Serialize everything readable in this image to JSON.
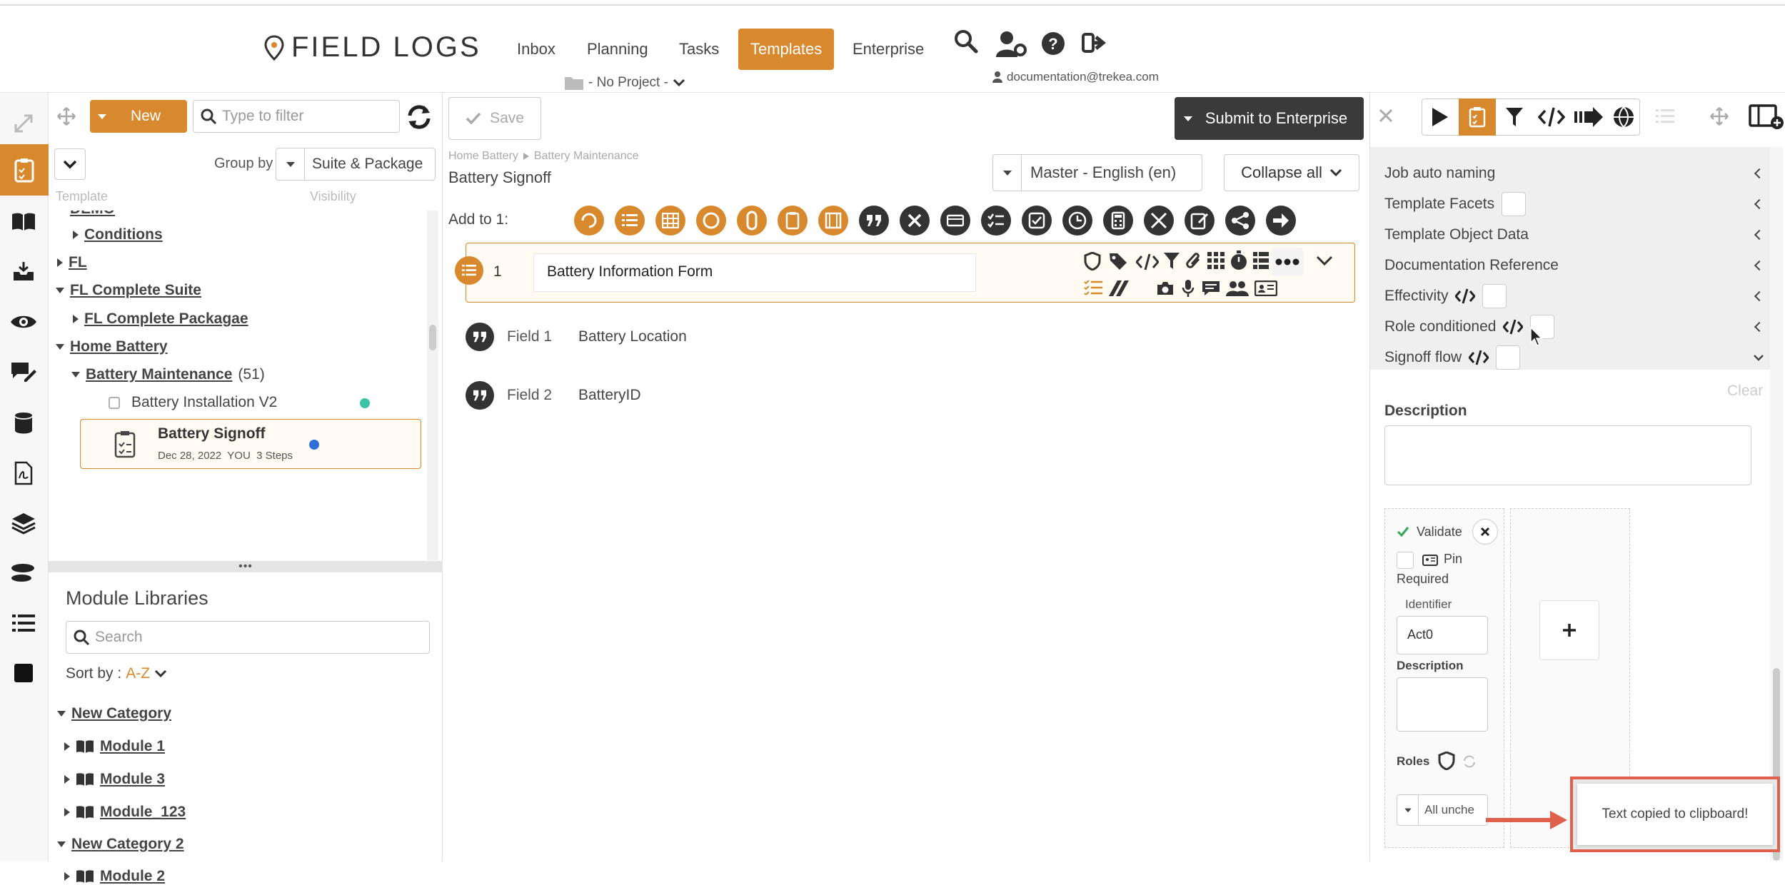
{
  "header": {
    "logo_text": "FIELD LOGS",
    "nav": [
      "Inbox",
      "Planning",
      "Tasks",
      "Templates",
      "Enterprise"
    ],
    "project": "- No Project -",
    "user": "documentation@trekea.com"
  },
  "toolbar": {
    "new_label": "New",
    "filter_placeholder": "Type to filter",
    "save_label": "Save",
    "submit_label": "Submit to Enterprise",
    "group_by_label": "Group by",
    "group_by_value": "Suite & Package",
    "col_template": "Template",
    "col_visibility": "Visibility"
  },
  "tree": {
    "items": [
      {
        "label": "DEMO",
        "level": 0
      },
      {
        "label": "Conditions",
        "level": 1
      },
      {
        "label": "FL",
        "level": 0
      },
      {
        "label": "FL Complete Suite",
        "level": 0
      },
      {
        "label": "FL Complete Packagae",
        "level": 1
      },
      {
        "label": "Home Battery",
        "level": 0
      },
      {
        "label": "Battery Maintenance",
        "count": "(51)",
        "level": 1
      },
      {
        "label": "Battery Installation V2",
        "level": 2
      },
      {
        "label": "Battery Signoff",
        "meta": "Dec 28, 2022  YOU  3 Steps",
        "level": 2
      }
    ]
  },
  "modules": {
    "title": "Module Libraries",
    "search_placeholder": "Search",
    "sort_label": "Sort by :",
    "sort_value": "A-Z",
    "items": [
      {
        "label": "New Category"
      },
      {
        "label": "Module 1"
      },
      {
        "label": "Module 3"
      },
      {
        "label": "Module_123"
      },
      {
        "label": "New Category 2"
      },
      {
        "label": "Module 2"
      }
    ]
  },
  "editor": {
    "breadcrumb": [
      "Home Battery",
      "Battery Maintenance"
    ],
    "title": "Battery Signoff",
    "language": "Master - English (en)",
    "collapse_label": "Collapse all",
    "add_to_label": "Add to 1:",
    "step_number": "1",
    "step_title": "Battery Information Form",
    "fields": [
      {
        "id": "Field 1",
        "label": "Battery Location"
      },
      {
        "id": "Field 2",
        "label": "BatteryID"
      }
    ]
  },
  "right": {
    "rows": [
      "Job auto naming",
      "Template Facets",
      "Template Object Data",
      "Documentation Reference",
      "Effectivity",
      "Role conditioned",
      "Signoff flow"
    ],
    "clear": "Clear",
    "description_label": "Description",
    "validate_label": "Validate",
    "pin_label": "Pin",
    "required_label": "Required",
    "identifier_label": "Identifier",
    "identifier_value": "Act0",
    "desc2_label": "Description",
    "roles_label": "Roles",
    "roles_value": "All unche",
    "toast": "Text copied to clipboard!"
  },
  "colors": {
    "accent": "#d9892d",
    "dark": "#333333",
    "toast_border": "#e0604e"
  }
}
